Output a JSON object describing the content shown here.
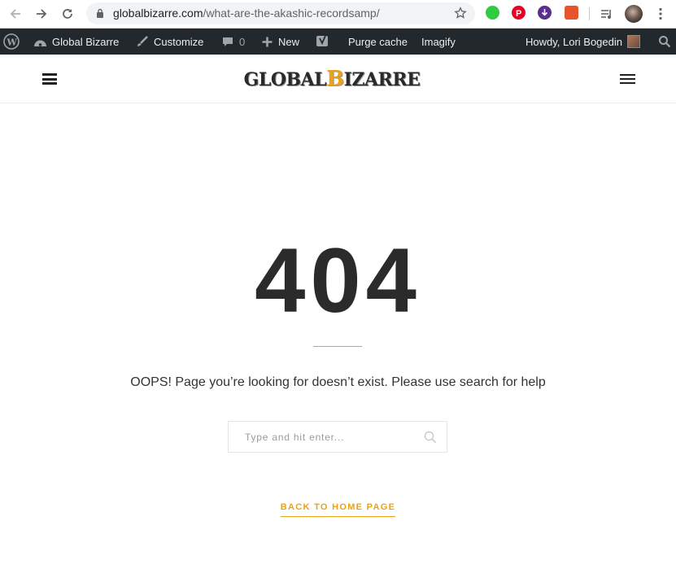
{
  "browser": {
    "url_domain": "globalbizarre.com",
    "url_path": "/what-are-the-akashic-recordsamp/",
    "icons": [
      "back-arrow-icon",
      "forward-arrow-icon",
      "reload-icon",
      "lock-icon",
      "star-icon",
      "extension-green-icon",
      "pinterest-icon",
      "download-icon",
      "extension-orange-icon",
      "media-control-icon",
      "profile-avatar",
      "more-vert-icon"
    ]
  },
  "adminbar": {
    "site_name": "Global Bizarre",
    "customize": "Customize",
    "comments_count": "0",
    "new": "New",
    "purge_cache": "Purge cache",
    "imagify": "Imagify",
    "howdy": "Howdy, Lori Bogedin"
  },
  "header": {
    "logo_part1": "Global",
    "logo_accent": "B",
    "logo_part2": "izarre"
  },
  "error": {
    "code": "404",
    "message": "OOPS! Page you’re looking for doesn’t exist. Please use search for help",
    "search_placeholder": "Type and hit enter...",
    "back_link": "BACK TO HOME PAGE"
  },
  "colors": {
    "accent": "#e8a317",
    "adminbar_bg": "#23282d",
    "text": "#333333"
  }
}
